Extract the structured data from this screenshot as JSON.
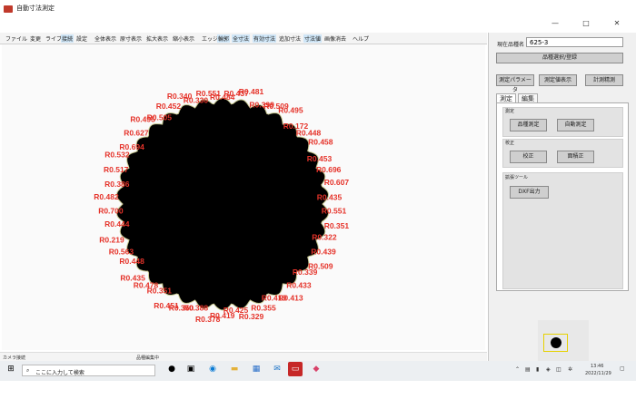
{
  "window": {
    "title": "自動寸法測定",
    "controls": [
      "—",
      "□",
      "✕"
    ]
  },
  "menu": {
    "items": [
      "ファイル",
      "変更",
      "ライブ",
      "接続",
      "設定",
      "全体表示",
      "原寸表示",
      "拡大表示",
      "縮小表示",
      "エッジ",
      "輪郭",
      "全寸法",
      "有効寸法",
      "追加寸法",
      "寸法値",
      "画像消去",
      "ヘルプ"
    ]
  },
  "measurements": [
    "R0.484",
    "R0.437",
    "R0.481",
    "R0.399",
    "R0.509",
    "R0.495",
    "R0.172",
    "R0.448",
    "R0.458",
    "R0.453",
    "R0.696",
    "R0.607",
    "R0.435",
    "R0.551",
    "R0.351",
    "R0.322",
    "R0.439",
    "R0.509",
    "R0.339",
    "R0.433",
    "R0.413",
    "R0.419",
    "R0.355",
    "R0.329",
    "R0.425",
    "R0.419",
    "R0.378",
    "R0.388",
    "R0.350",
    "R0.451",
    "R0.351",
    "R0.478",
    "R0.435",
    "R0.448",
    "R0.563",
    "R0.219",
    "R0.444",
    "R0.700",
    "R0.482",
    "R0.386",
    "R0.517",
    "R0.532",
    "R0.694",
    "R0.627",
    "R0.495",
    "R0.505",
    "R0.452",
    "R0.340",
    "R0.330",
    "R0.551"
  ],
  "status": {
    "camera": "カメラ接続",
    "mode": "品種編集中"
  },
  "panel": {
    "product_label": "現在品種名",
    "product_value": "625-3",
    "select_button": "品種選択/登録",
    "param_button": "測定パラメータ",
    "display_button": "測定値表示",
    "record_button": "計測精測",
    "tabs": [
      "測定",
      "編集"
    ],
    "group_measure": "測定",
    "btn_kind_measure": "品種測定",
    "btn_auto_measure": "自動測定",
    "group_calib": "校正",
    "btn_calib": "校正",
    "btn_correct": "面積正",
    "group_ext": "拡張ツール",
    "btn_dxf": "DXF出力"
  },
  "taskbar": {
    "search_placeholder": "ここに入力して検索",
    "time": "13:46",
    "date": "2022/11/29"
  }
}
